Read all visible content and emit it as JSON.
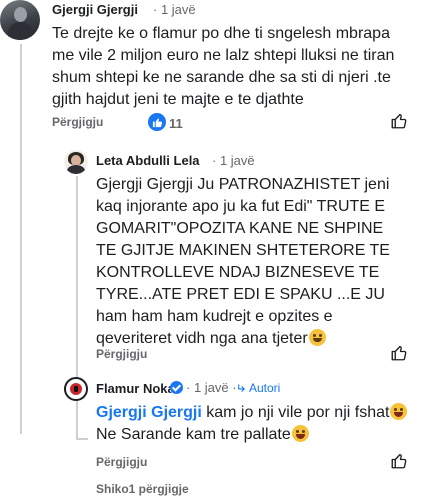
{
  "comments": [
    {
      "author": "Gjergji Gjergji",
      "time": "1 javë",
      "text": "Te drejte ke o flamur po dhe ti sngelesh mbrapa me vile 2 miljon euro ne lalz shtepi lluksi ne tiran shum shtepi ke ne sarande dhe sa sti di njeri .te gjith hajdut jeni te majte e te djathte",
      "reply_label": "Përgjigju",
      "reaction_count": "11"
    },
    {
      "author": "Leta Abdulli Lela",
      "time": "1 javë",
      "text": "Gjergji Gjergji Ju PATRONAZHISTET jeni kaq injorante apo ju ka fut Edi\" TRUTE E GOMARIT\"OPOZITA KANE NE SHPINE TE GJITJE MAKINEN SHTETERORE TE KONTROLLEVE NDAJ BIZNESEVE TE TYRE...ATE PRET EDI E SPAKU ...E JU ham ham ham kudrejt e opzites e qeveriteret vidh nga ana tjeter",
      "reply_label": "Përgjigju"
    },
    {
      "author": "Flamur Noka",
      "time": "1 javë",
      "badge": "Autori",
      "mention": "Gjergji Gjergji",
      "text_line1": " kam jo nji vile por nji fshat",
      "text_line2": "Ne Sarande kam tre pallate",
      "reply_label": "Përgjigju"
    }
  ],
  "more_replies": "Shiko1 përgjigje",
  "colors": {
    "accent": "#1877f2",
    "muted": "#65676b",
    "text": "#1c1e21"
  },
  "icons": [
    "like-icon",
    "thumbs-up-reaction-icon",
    "verified-badge-icon",
    "author-arrow-icon",
    "laughing-emoji-icon",
    "winking-emoji-icon"
  ]
}
